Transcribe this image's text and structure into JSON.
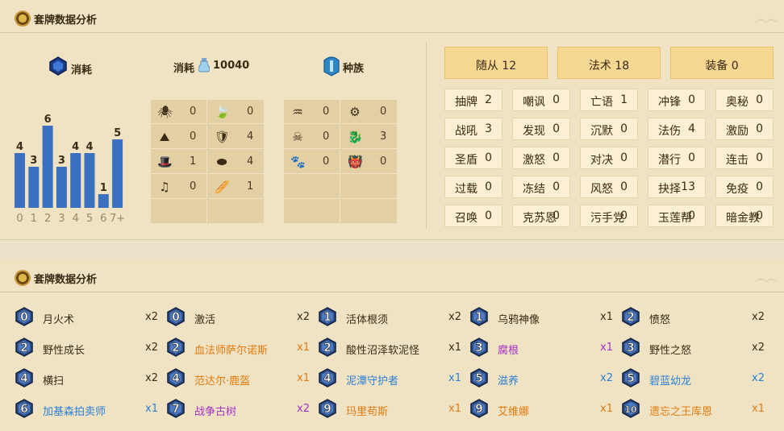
{
  "top": {
    "title": "套牌数据分析"
  },
  "cost_section": {
    "title": "消耗"
  },
  "dust_section": {
    "label": "消耗",
    "value": "10040"
  },
  "race_section": {
    "title": "种族"
  },
  "chart_data": {
    "type": "bar",
    "categories": [
      "0",
      "1",
      "2",
      "3",
      "4",
      "5",
      "6",
      "7+"
    ],
    "values": [
      4,
      3,
      6,
      3,
      4,
      4,
      1,
      5
    ],
    "color": "#3b70c0"
  },
  "class_grid": [
    {
      "icon": "spider-icon",
      "glyph": "🕷",
      "value": "0"
    },
    {
      "icon": "leaf-icon",
      "glyph": "🍃",
      "value": "0"
    },
    {
      "icon": "mountain-icon",
      "glyph": "⛰",
      "value": "0"
    },
    {
      "icon": "shield-icon",
      "glyph": "🛡",
      "value": "4"
    },
    {
      "icon": "hat-icon",
      "glyph": "🎩",
      "value": "1"
    },
    {
      "icon": "purple-eye-icon",
      "glyph": "⬬",
      "value": "4"
    },
    {
      "icon": "music-note-icon",
      "glyph": "♫",
      "value": "0"
    },
    {
      "icon": "loaf-icon",
      "glyph": "🥖",
      "value": "1"
    }
  ],
  "race_grid": [
    {
      "icon": "murloc-icon",
      "glyph": "♒",
      "value": "0"
    },
    {
      "icon": "mech-gear-icon",
      "glyph": "⚙",
      "value": "0"
    },
    {
      "icon": "pirate-icon",
      "glyph": "☠",
      "value": "0"
    },
    {
      "icon": "dragon-icon",
      "glyph": "🐉",
      "value": "3"
    },
    {
      "icon": "beast-paw-icon",
      "glyph": "🐾",
      "value": "0"
    },
    {
      "icon": "demon-icon",
      "glyph": "👹",
      "value": "0"
    }
  ],
  "type_buttons": [
    {
      "label": "随从",
      "count": "12"
    },
    {
      "label": "法术",
      "count": "18"
    },
    {
      "label": "装备",
      "count": "0"
    }
  ],
  "mechanics": [
    {
      "label": "抽牌",
      "count": "2"
    },
    {
      "label": "嘲讽",
      "count": "0"
    },
    {
      "label": "亡语",
      "count": "1"
    },
    {
      "label": "冲锋",
      "count": "0"
    },
    {
      "label": "奥秘",
      "count": "0"
    },
    {
      "label": "战吼",
      "count": "3"
    },
    {
      "label": "发现",
      "count": "0"
    },
    {
      "label": "沉默",
      "count": "0"
    },
    {
      "label": "法伤",
      "count": "4"
    },
    {
      "label": "激励",
      "count": "0"
    },
    {
      "label": "圣盾",
      "count": "0"
    },
    {
      "label": "激怒",
      "count": "0"
    },
    {
      "label": "对决",
      "count": "0"
    },
    {
      "label": "潜行",
      "count": "0"
    },
    {
      "label": "连击",
      "count": "0"
    },
    {
      "label": "过载",
      "count": "0"
    },
    {
      "label": "冻结",
      "count": "0"
    },
    {
      "label": "风怒",
      "count": "0"
    },
    {
      "label": "抉择",
      "count": "13"
    },
    {
      "label": "免疫",
      "count": "0"
    },
    {
      "label": "召唤",
      "count": "0"
    },
    {
      "label": "克苏恩",
      "count": "0"
    },
    {
      "label": "污手党",
      "count": "0"
    },
    {
      "label": "玉莲帮",
      "count": "0"
    },
    {
      "label": "暗金教",
      "count": "0"
    }
  ],
  "bottom": {
    "title": "套牌数据分析"
  },
  "cards": [
    {
      "cost": "0",
      "name": "月火术",
      "qty": "x2",
      "rarity": "normal"
    },
    {
      "cost": "0",
      "name": "激活",
      "qty": "x2",
      "rarity": "normal"
    },
    {
      "cost": "1",
      "name": "活体根须",
      "qty": "x2",
      "rarity": "normal"
    },
    {
      "cost": "1",
      "name": "乌鸦神像",
      "qty": "x1",
      "rarity": "normal"
    },
    {
      "cost": "2",
      "name": "愤怒",
      "qty": "x2",
      "rarity": "normal"
    },
    {
      "cost": "2",
      "name": "野性成长",
      "qty": "x2",
      "rarity": "normal"
    },
    {
      "cost": "2",
      "name": "血法师萨尔诺斯",
      "qty": "x1",
      "rarity": "legend"
    },
    {
      "cost": "2",
      "name": "酸性沼泽软泥怪",
      "qty": "x1",
      "rarity": "normal"
    },
    {
      "cost": "3",
      "name": "腐根",
      "qty": "x1",
      "rarity": "epic"
    },
    {
      "cost": "3",
      "name": "野性之怒",
      "qty": "x2",
      "rarity": "normal"
    },
    {
      "cost": "4",
      "name": "横扫",
      "qty": "x2",
      "rarity": "normal"
    },
    {
      "cost": "4",
      "name": "范达尔·鹿盔",
      "qty": "x1",
      "rarity": "legend"
    },
    {
      "cost": "4",
      "name": "泥潭守护者",
      "qty": "x1",
      "rarity": "rare"
    },
    {
      "cost": "5",
      "name": "滋养",
      "qty": "x2",
      "rarity": "rare"
    },
    {
      "cost": "5",
      "name": "碧蓝幼龙",
      "qty": "x2",
      "rarity": "rare"
    },
    {
      "cost": "6",
      "name": "加基森拍卖师",
      "qty": "x1",
      "rarity": "rare"
    },
    {
      "cost": "7",
      "name": "战争古树",
      "qty": "x2",
      "rarity": "epic"
    },
    {
      "cost": "9",
      "name": "玛里苟斯",
      "qty": "x1",
      "rarity": "legend"
    },
    {
      "cost": "9",
      "name": "艾维娜",
      "qty": "x1",
      "rarity": "legend"
    },
    {
      "cost": "10",
      "name": "遗忘之王库恩",
      "qty": "x1",
      "rarity": "legend"
    }
  ]
}
